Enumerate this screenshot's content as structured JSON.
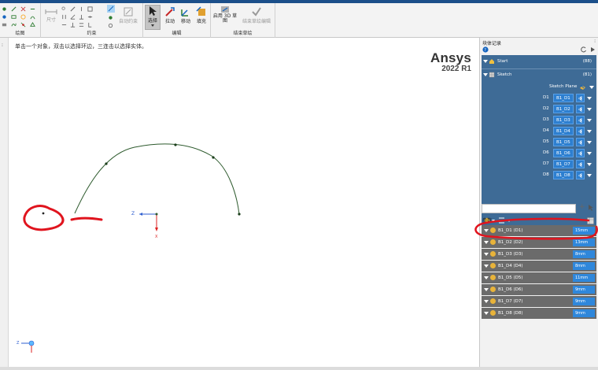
{
  "ribbon": {
    "groups": {
      "sketch_label": "绘图",
      "constraint_label": "约束",
      "edit_label": "编辑",
      "finish_label": "结束草绘"
    },
    "buttons": {
      "dimension": "尺寸",
      "auto_constrain": "自动约束",
      "select": "选择",
      "pull": "拉动",
      "move": "移动",
      "fill": "填充",
      "enable_3d_line1": "启用",
      "enable_3d_line2": "3D 草",
      "enable_3d_line3": "图",
      "finish_sketch": "结束草绘编辑"
    }
  },
  "canvas": {
    "hint": "单击一个对象，双击以选择环边，三连击以选择实体。",
    "logo_brand": "Ansys",
    "logo_version": "2022 R1",
    "axis_z": "Z",
    "axis_x": "X"
  },
  "panel": {
    "block_record_title": "块体记录",
    "tree": {
      "start_label": "Start",
      "start_count": "(88)",
      "sketch_label": "Sketch",
      "sketch_count": "(81)",
      "plane_label": "Sketch Plane"
    },
    "d_rows": [
      {
        "label": "D1",
        "value": "B1_D1"
      },
      {
        "label": "D2",
        "value": "B1_D2"
      },
      {
        "label": "D3",
        "value": "B1_D3"
      },
      {
        "label": "D4",
        "value": "B1_D4"
      },
      {
        "label": "D5",
        "value": "B1_D5"
      },
      {
        "label": "D6",
        "value": "B1_D6"
      },
      {
        "label": "D7",
        "value": "B1_D7"
      },
      {
        "label": "D8",
        "value": "B1_D8"
      }
    ],
    "params_title": "参数",
    "dims": [
      {
        "name": "B1_D1 (D1)",
        "value": "15mm"
      },
      {
        "name": "B1_D2 (D2)",
        "value": "13mm"
      },
      {
        "name": "B1_D3 (D3)",
        "value": "8mm"
      },
      {
        "name": "B1_D4 (D4)",
        "value": "8mm"
      },
      {
        "name": "B1_D5 (D5)",
        "value": "11mm"
      },
      {
        "name": "B1_D6 (D6)",
        "value": "9mm"
      },
      {
        "name": "B1_D7 (D7)",
        "value": "9mm"
      },
      {
        "name": "B1_D8 (D8)",
        "value": "9mm"
      }
    ]
  },
  "colors": {
    "tree_bg": "#3e6b96",
    "field_blue": "#2d7fd0",
    "dim_row": "#6b6b6b",
    "annotation_red": "#e0141e"
  }
}
